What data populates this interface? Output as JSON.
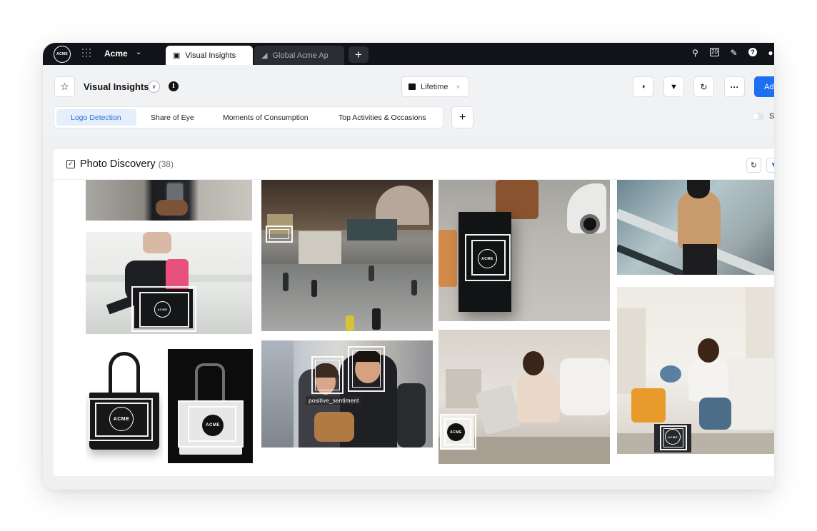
{
  "topbar": {
    "logo_text": "ACME",
    "workspace": "Acme",
    "tabs": [
      {
        "label": "Visual Insights",
        "active": true
      },
      {
        "label": "Global Acme Ap",
        "active": false
      }
    ],
    "calendar_day": "20"
  },
  "header": {
    "title": "Visual Insights",
    "date_range": "Lifetime",
    "add_label": "Ad",
    "subtabs": [
      "Logo Detection",
      "Share of Eye",
      "Moments of Consumption",
      "Top Activities & Occasions"
    ],
    "selected_subtab": "Logo Detection",
    "toggle_label": "S"
  },
  "card": {
    "title": "Photo Discovery",
    "count": "(38)",
    "photos": [
      {
        "name": "phone-hands"
      },
      {
        "name": "traveler-pink-luggage",
        "logo": "ACME"
      },
      {
        "name": "black-tote-bag",
        "logo": "ACME"
      },
      {
        "name": "white-tote-bag",
        "logo": "ACME"
      },
      {
        "name": "train-station-hall"
      },
      {
        "name": "friends-on-train",
        "tag": "positive_sentiment"
      },
      {
        "name": "shopping-bag-airport",
        "logo": "ACME"
      },
      {
        "name": "woman-packing-suitcase",
        "logo": "ACME"
      },
      {
        "name": "escalator-traveler"
      },
      {
        "name": "woman-living-room",
        "logo": "ACME"
      }
    ]
  },
  "colors": {
    "topbar": "#111318",
    "accent": "#1f6ff2",
    "selected_tab_bg": "#e5eefb",
    "selected_tab_text": "#2a6fdb"
  }
}
